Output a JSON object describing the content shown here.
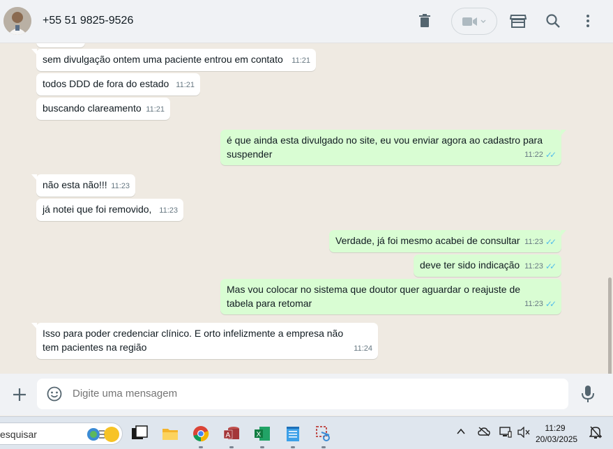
{
  "header": {
    "contact_name": "+55 51 9825-9526"
  },
  "messages": [
    {
      "dir": "in",
      "text": "sem divulgação ontem uma paciente entrou em contato",
      "time": "11:21"
    },
    {
      "dir": "in",
      "text": "todos DDD de fora do estado",
      "time": "11:21"
    },
    {
      "dir": "in",
      "text": "buscando clareamento",
      "time": "11:21"
    },
    {
      "dir": "out",
      "text": "é que ainda esta divulgado no site, eu vou enviar agora ao cadastro para suspender",
      "time": "11:22"
    },
    {
      "dir": "in",
      "text": "não esta não!!!",
      "time": "11:23"
    },
    {
      "dir": "in",
      "text": "já notei que foi removido,",
      "time": "11:23"
    },
    {
      "dir": "out",
      "text": "Verdade, já foi mesmo acabei de consultar",
      "time": "11:23"
    },
    {
      "dir": "out",
      "text": "deve ter sido indicação",
      "time": "11:23"
    },
    {
      "dir": "out",
      "text": "Mas vou colocar no sistema que doutor quer aguardar o reajuste de tabela para retomar",
      "time": "11:23"
    },
    {
      "dir": "in",
      "text": "Isso para poder credenciar clínico. E orto infelizmente a empresa não tem pacientes na região",
      "time": "11:24"
    }
  ],
  "composer": {
    "placeholder": "Digite uma mensagem"
  },
  "taskbar": {
    "search_text": "esquisar",
    "time": "11:29",
    "date": "20/03/2025"
  },
  "colors": {
    "incoming_bubble": "#ffffff",
    "outgoing_bubble": "#d9fdd3",
    "chat_background": "#efeae2",
    "read_ticks": "#53bdeb"
  }
}
